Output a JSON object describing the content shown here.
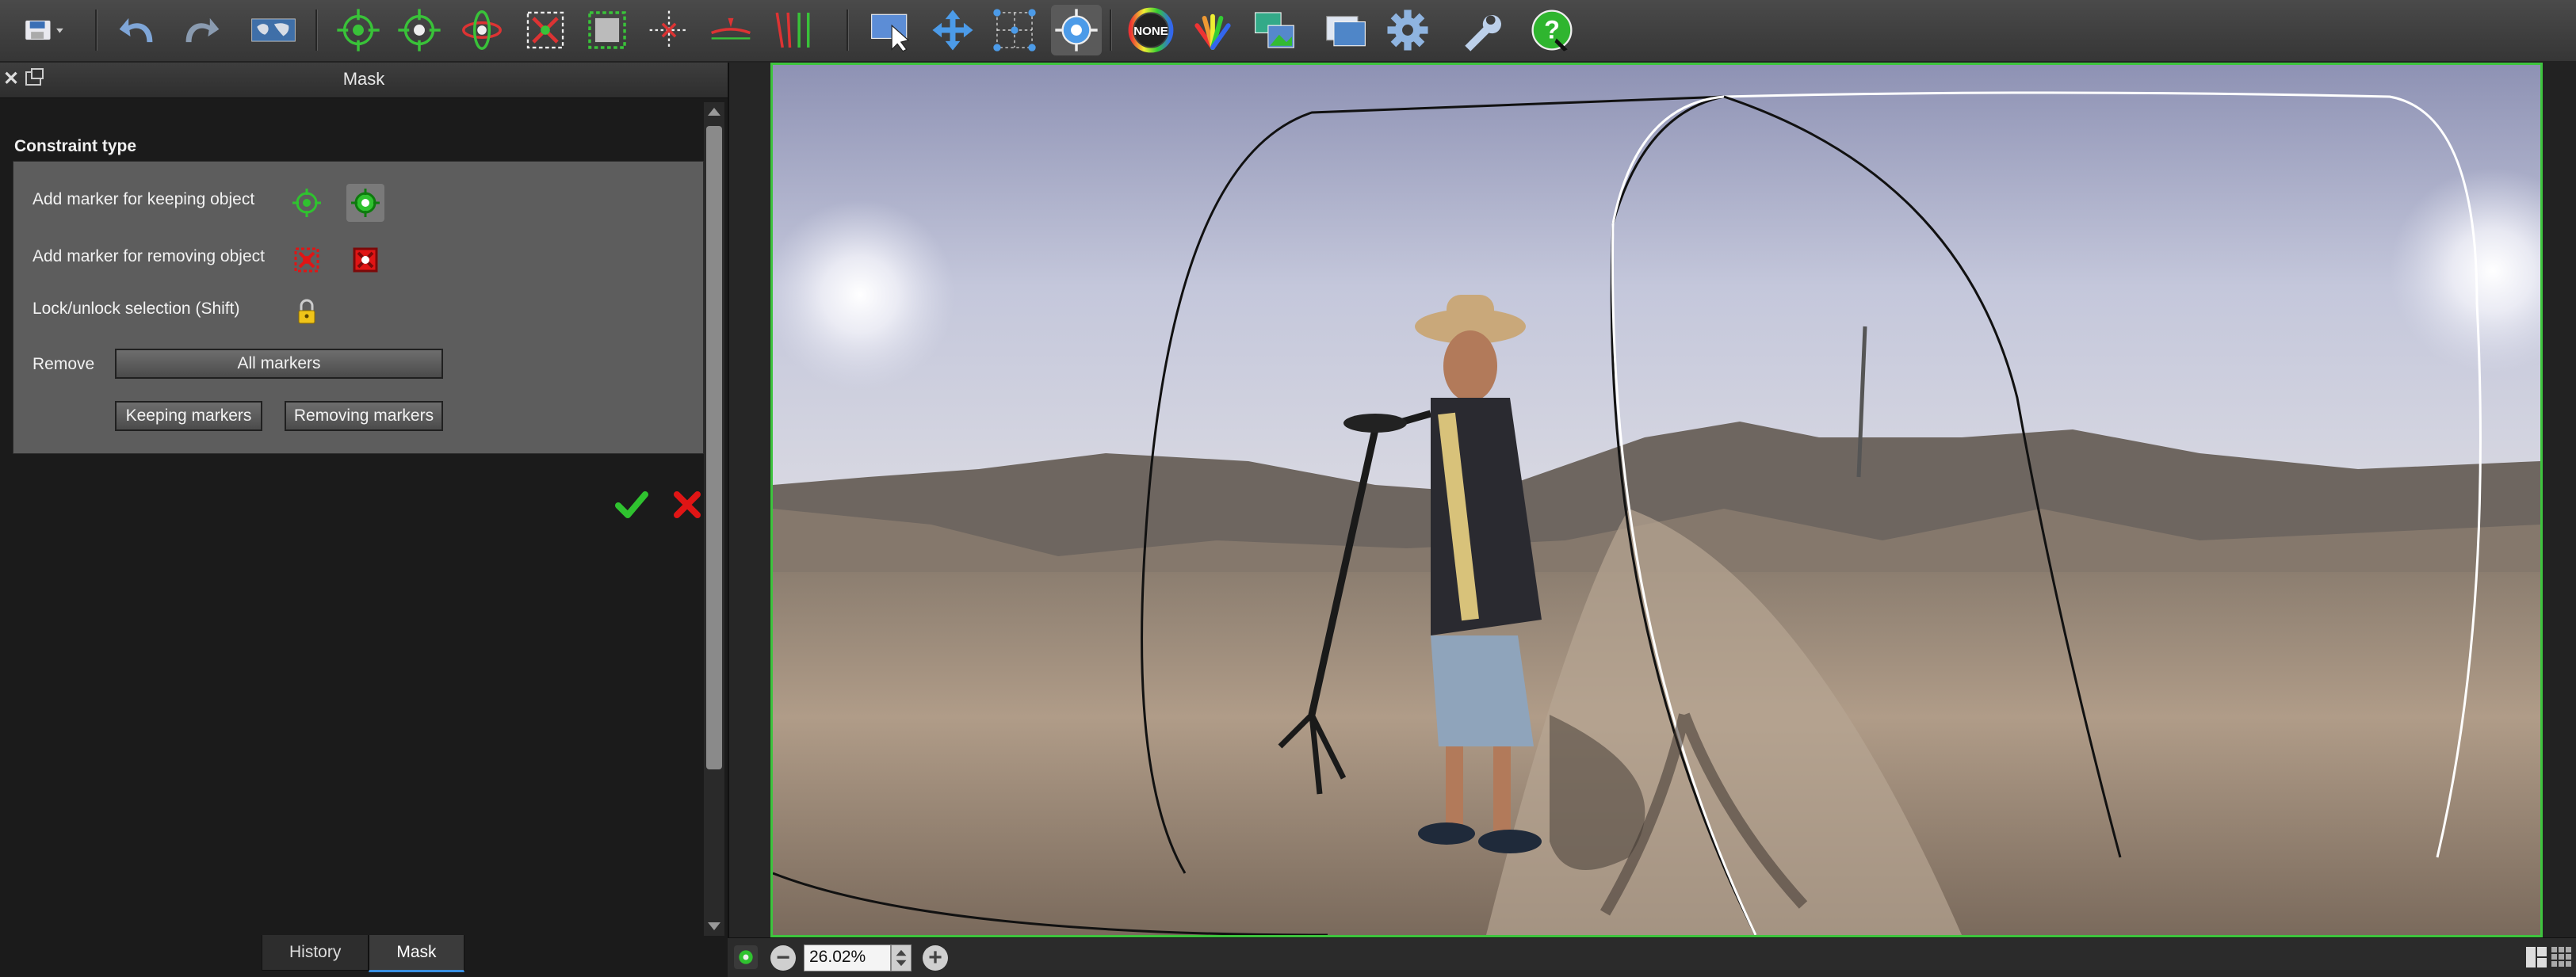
{
  "toolbar": {
    "items": [
      {
        "name": "save-menu-icon"
      },
      {
        "name": "undo-icon"
      },
      {
        "name": "redo-icon"
      },
      {
        "name": "world-map-icon"
      },
      {
        "name": "add-marker-icon"
      },
      {
        "name": "add-marker-auto-icon"
      },
      {
        "name": "rotate-icon"
      },
      {
        "name": "crop-icon"
      },
      {
        "name": "frame-icon"
      },
      {
        "name": "crosshair-icon"
      },
      {
        "name": "horizon-icon"
      },
      {
        "name": "vertical-lines-icon"
      },
      {
        "name": "select-icon"
      },
      {
        "name": "move-icon"
      },
      {
        "name": "grid-points-icon"
      },
      {
        "name": "target-icon"
      },
      {
        "name": "color-none-icon",
        "label": "NONE"
      },
      {
        "name": "color-fan-icon"
      },
      {
        "name": "images-icon"
      },
      {
        "name": "output-icon"
      },
      {
        "name": "gear-icon"
      },
      {
        "name": "wrench-icon"
      },
      {
        "name": "help-icon"
      }
    ]
  },
  "panel": {
    "title": "Mask",
    "constraint_label": "Constraint type",
    "rows": {
      "keep": "Add marker for keeping object",
      "remove": "Add marker for removing object",
      "lock": "Lock/unlock selection (Shift)",
      "remove_label": "Remove"
    },
    "buttons": {
      "all_markers": "All markers",
      "keeping_markers": "Keeping markers",
      "removing_markers": "Removing markers"
    }
  },
  "tabs": {
    "history": "History",
    "mask": "Mask"
  },
  "status": {
    "zoom": "26.02%"
  },
  "colors": {
    "accent_green": "#3ec43e",
    "remove_red": "#e01515",
    "active_tab": "#3a8fe0"
  }
}
